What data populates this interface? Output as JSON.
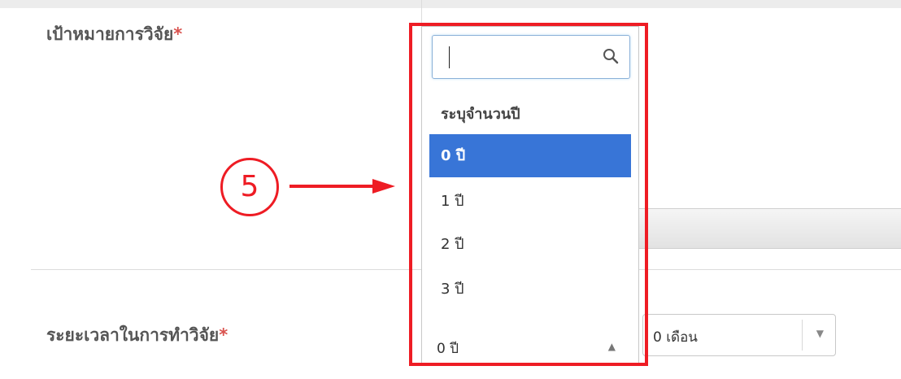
{
  "form": {
    "research_goal_label": "เป้าหมายการวิจัย",
    "research_duration_label": "ระยะเวลาในการทำวิจัย",
    "required_mark": "*"
  },
  "dropdown": {
    "search_value": "",
    "search_icon": "search-icon",
    "options": [
      {
        "label": "ระบุจำนวนปี",
        "type": "heading"
      },
      {
        "label": "0 ปี",
        "selected": true
      },
      {
        "label": "1 ปี"
      },
      {
        "label": "2 ปี"
      },
      {
        "label": "3 ปี"
      }
    ],
    "current_value": "0 ปี"
  },
  "month_select": {
    "value": "0 เดือน"
  },
  "annotation": {
    "step_number": "5",
    "color": "#ee1c24"
  },
  "colors": {
    "selected_bg": "#3875d7",
    "required": "#d9534f"
  }
}
